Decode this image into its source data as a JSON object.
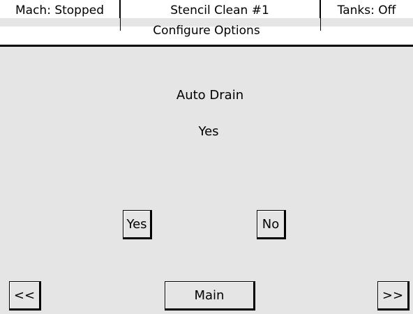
{
  "status": {
    "machine": "Mach: Stopped",
    "program": "Stencil Clean #1",
    "tanks": "Tanks: Off"
  },
  "screen_title": "Configure Options",
  "option": {
    "label": "Auto Drain",
    "current_value": "Yes"
  },
  "choices": {
    "yes": "Yes",
    "no": "No"
  },
  "nav": {
    "prev": "<<",
    "main": "Main",
    "next": ">>"
  }
}
